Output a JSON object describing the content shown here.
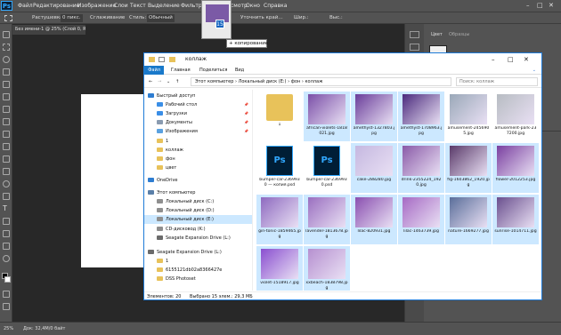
{
  "ps": {
    "logo": "Ps",
    "menu": [
      "Файл",
      "Редактирование",
      "Изображение",
      "Слои",
      "Текст",
      "Выделение",
      "Фильтр",
      "3D",
      "Просмотр",
      "Окно",
      "Справка"
    ],
    "options": {
      "feather_label": "Растушевка:",
      "feather_value": "0 пикс.",
      "style_label": "Стиль:",
      "style_value": "Обычный",
      "antialias": "Сглаживание",
      "refine": "Уточнить край…",
      "width_label": "Шир.:",
      "height_label": "Выс.:"
    },
    "doc_tab": "Без имени-1 @ 25% (Слой 0, RGB/8) *",
    "panel_tabs": [
      "Цвет",
      "Образцы"
    ],
    "status_left": "25%",
    "status_doc": "Док: 32,4M/0 байт",
    "colors": {
      "bg": "#282828",
      "chrome": "#535353",
      "accent": "#31a8ff"
    }
  },
  "drag": {
    "badge": "15",
    "tooltip": "+ копирование"
  },
  "explorer": {
    "title": "коллаж",
    "ribbon": {
      "file": "Файл",
      "tabs": [
        "Главная",
        "Поделиться",
        "Вид"
      ]
    },
    "address": [
      "Этот компьютер",
      "Локальный диск (E:)",
      "фон",
      "коллаж"
    ],
    "search_placeholder": "Поиск: коллаж",
    "nav": [
      {
        "label": "Быстрый доступ",
        "icon": "star-icon",
        "color": "#2e7dd1",
        "pin": false
      },
      {
        "label": "Рабочий стол",
        "icon": "desktop-icon",
        "color": "#3a8ee6",
        "pin": true
      },
      {
        "label": "Загрузки",
        "icon": "download-icon",
        "color": "#3a8ee6",
        "pin": true
      },
      {
        "label": "Документы",
        "icon": "documents-icon",
        "color": "#8a9bb0",
        "pin": true
      },
      {
        "label": "Изображения",
        "icon": "pictures-icon",
        "color": "#5aa1e0",
        "pin": true
      },
      {
        "label": "1",
        "icon": "folder-icon",
        "color": "#e8c25a",
        "pin": false
      },
      {
        "label": "коллаж",
        "icon": "folder-icon",
        "color": "#e8c25a",
        "pin": false
      },
      {
        "label": "фон",
        "icon": "folder-icon",
        "color": "#e8c25a",
        "pin": false
      },
      {
        "label": "цвет",
        "icon": "folder-icon",
        "color": "#e8c25a",
        "pin": false
      },
      {
        "label": "OneDrive",
        "icon": "cloud-icon",
        "color": "#2e7dd1",
        "pin": false
      },
      {
        "label": "Этот компьютер",
        "icon": "computer-icon",
        "color": "#5a7fa8",
        "pin": false
      },
      {
        "label": "Локальный диск (C:)",
        "icon": "drive-icon",
        "color": "#8f8f8f",
        "pin": false
      },
      {
        "label": "Локальный диск (D:)",
        "icon": "drive-icon",
        "color": "#8f8f8f",
        "pin": false
      },
      {
        "label": "Локальный диск (E:)",
        "icon": "drive-icon",
        "color": "#8f8f8f",
        "pin": false
      },
      {
        "label": "CD-дисковод (K:)",
        "icon": "cd-icon",
        "color": "#8f8f8f",
        "pin": false
      },
      {
        "label": "Seagate Expansion Drive (L:)",
        "icon": "drive-icon",
        "color": "#6b6b6b",
        "pin": false
      },
      {
        "label": "Seagate Expansion Drive (L:)",
        "icon": "drive-icon",
        "color": "#6b6b6b",
        "pin": false
      },
      {
        "label": "1",
        "icon": "folder-icon",
        "color": "#e8c25a",
        "pin": false
      },
      {
        "label": "6155121db02a8366427e",
        "icon": "folder-icon",
        "color": "#e8c25a",
        "pin": false
      },
      {
        "label": "DSS Photoset",
        "icon": "folder-icon",
        "color": "#e8c25a",
        "pin": false
      }
    ],
    "files": [
      {
        "name": "1",
        "kind": "folder",
        "color": "#e8c25a",
        "sel": false
      },
      {
        "name": "african-violets-1818021.jpg",
        "kind": "img",
        "color": "#7b4fa8",
        "sel": true
      },
      {
        "name": "amethyst-1327803.jpg",
        "kind": "img",
        "color": "#6a3d9a",
        "sel": true
      },
      {
        "name": "amethyst-1708963.jpg",
        "kind": "img",
        "color": "#4b2a7d",
        "sel": true
      },
      {
        "name": "amusement-2456905.jpg",
        "kind": "img",
        "color": "#9aa8b8",
        "sel": false
      },
      {
        "name": "amusement-park-237200.jpg",
        "kind": "img",
        "color": "#b7bcc2",
        "sel": false
      },
      {
        "name": "bumper-car-2369930 — копия.psd",
        "kind": "psd",
        "color": "#001e36",
        "sel": false
      },
      {
        "name": "bumper-car-2369930.psd",
        "kind": "psd",
        "color": "#001e36",
        "sel": false
      },
      {
        "name": "cake-288280.jpg",
        "kind": "img",
        "color": "#c5b8e0",
        "sel": true
      },
      {
        "name": "drink-2355224_1920.jpg",
        "kind": "img",
        "color": "#8a5aa8",
        "sel": true
      },
      {
        "name": "fig-1603862_1920.jpg",
        "kind": "img",
        "color": "#5a3a6a",
        "sel": true
      },
      {
        "name": "flower-2012253.jpg",
        "kind": "img",
        "color": "#7a3fa0",
        "sel": true
      },
      {
        "name": "gin-tonic-1859465.jpg",
        "kind": "img",
        "color": "#8e6ac0",
        "sel": true
      },
      {
        "name": "lavender-1813678.jpg",
        "kind": "img",
        "color": "#9a6fc0",
        "sel": true
      },
      {
        "name": "lilac-820931.jpg",
        "kind": "img",
        "color": "#8a4fb0",
        "sel": true
      },
      {
        "name": "lilac-1463739.jpg",
        "kind": "img",
        "color": "#a66ac4",
        "sel": true
      },
      {
        "name": "nature-1669277.jpg",
        "kind": "img",
        "color": "#5a6e9a",
        "sel": true
      },
      {
        "name": "sunrise-1014711.jpg",
        "kind": "img",
        "color": "#6a4f8e",
        "sel": true
      },
      {
        "name": "violet-1518917.jpg",
        "kind": "img",
        "color": "#8a4fd0",
        "sel": true
      },
      {
        "name": "xxbeach-1838798.jpg",
        "kind": "img",
        "color": "#b690d0",
        "sel": true
      }
    ],
    "status": {
      "count": "Элементов: 20",
      "selected": "Выбрано 15 элем.: 29,3 МБ"
    }
  }
}
